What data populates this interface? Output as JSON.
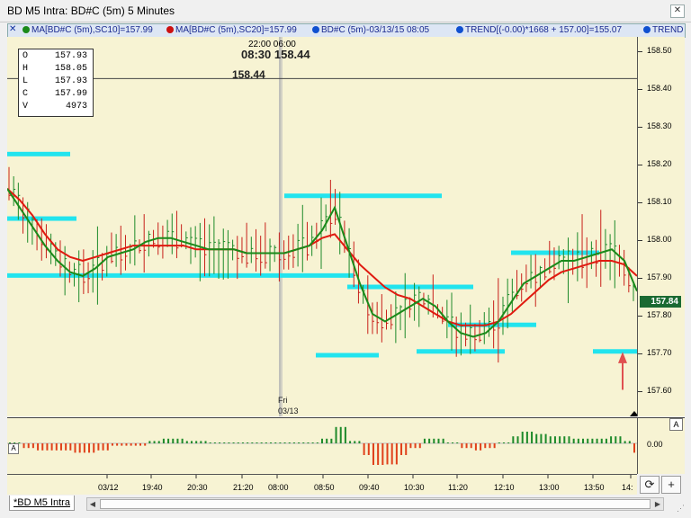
{
  "window": {
    "title": "BD M5 Intra: BD#C (5m) 5 Minutes",
    "close_glyph": "✕"
  },
  "legend": {
    "close_glyph": "✕",
    "items": [
      {
        "label": "MA[BD#C (5m),SC10]=157.99",
        "color": "#1a8a1a"
      },
      {
        "label": "MA[BD#C (5m),SC20]=157.99",
        "color": "#cc1010"
      },
      {
        "label": "BD#C (5m)-03/13/15 08:05",
        "color": "#1050d0"
      },
      {
        "label": "TREND[(-0.00)*1668 + 157.00]=155.07",
        "color": "#1050d0"
      },
      {
        "label": "TREND",
        "color": "#1050d0"
      }
    ]
  },
  "ohlc": {
    "rows": [
      {
        "k": "O",
        "v": "157.93"
      },
      {
        "k": "H",
        "v": "158.05"
      },
      {
        "k": "L",
        "v": "157.93"
      },
      {
        "k": "C",
        "v": "157.99"
      },
      {
        "k": "V",
        "v": "4973"
      }
    ]
  },
  "crosshair": {
    "time_top": "22:00  06:00",
    "time_big": "08:30  158.44",
    "price": "158.44"
  },
  "price_axis": {
    "min": 157.55,
    "max": 158.55,
    "labels": [
      "158.50",
      "158.40",
      "158.30",
      "158.20",
      "158.10",
      "158.00",
      "157.90",
      "157.80",
      "157.70",
      "157.60"
    ],
    "last_price": "157.84"
  },
  "osc_axis": {
    "zero_label": "0.00",
    "a_button": "A"
  },
  "session_marker": {
    "day": "Fri",
    "date": "03/13"
  },
  "time_axis": {
    "labels": [
      "03/12",
      "19:40",
      "20:30",
      "21:20",
      "08:00",
      "08:50",
      "09:40",
      "10:30",
      "11:20",
      "12:10",
      "13:00",
      "13:50",
      "14:"
    ]
  },
  "toolbar": {
    "refresh_icon": "⟳",
    "add_icon": "+"
  },
  "tabs": [
    {
      "label": "*BD M5 Intra"
    }
  ],
  "scroll": {
    "left_arrow": "◀",
    "right_arrow": "▶",
    "grip": "⋰"
  },
  "colors": {
    "background": "#f7f3d3",
    "up_bar": "#1d8a2a",
    "down_bar": "#c8201a",
    "ma10": "#1a8a1a",
    "ma20": "#e01a10",
    "trend_cyan": "#22e4ee",
    "annotation_arrow": "#e05050"
  },
  "chart_data": {
    "type": "bar",
    "series": [
      {
        "name": "MA SC10",
        "color": "#1a8a1a",
        "values": [
          158.15,
          158.1,
          158.05,
          158.0,
          157.96,
          157.93,
          157.92,
          157.94,
          157.97,
          157.98,
          157.99,
          158.01,
          158.02,
          158.02,
          158.01,
          158.0,
          157.99,
          157.99,
          157.99,
          157.98,
          157.98,
          157.98,
          157.98,
          157.99,
          158.0,
          158.04,
          158.1,
          158.0,
          157.9,
          157.82,
          157.8,
          157.82,
          157.84,
          157.86,
          157.84,
          157.8,
          157.77,
          157.76,
          157.77,
          157.8,
          157.85,
          157.9,
          157.92,
          157.94,
          157.96,
          157.96,
          157.97,
          157.98,
          157.99,
          157.96,
          157.88
        ]
      },
      {
        "name": "MA SC20",
        "color": "#e01a10",
        "values": [
          158.15,
          158.12,
          158.08,
          158.03,
          157.99,
          157.97,
          157.96,
          157.97,
          157.98,
          157.99,
          158.0,
          158.0,
          158.0,
          158.0,
          158.0,
          157.99,
          157.99,
          157.99,
          157.99,
          157.98,
          157.98,
          157.98,
          157.98,
          157.99,
          158.0,
          158.02,
          158.03,
          157.99,
          157.95,
          157.92,
          157.89,
          157.87,
          157.86,
          157.84,
          157.82,
          157.8,
          157.79,
          157.79,
          157.79,
          157.8,
          157.82,
          157.85,
          157.88,
          157.91,
          157.93,
          157.94,
          157.95,
          157.96,
          157.96,
          157.95,
          157.92
        ]
      }
    ],
    "horizontal_levels": [
      {
        "y": 158.24,
        "x_start": 0.0,
        "x_end": 0.1
      },
      {
        "y": 158.07,
        "x_start": 0.0,
        "x_end": 0.11
      },
      {
        "y": 157.92,
        "x_start": 0.0,
        "x_end": 0.55
      },
      {
        "y": 158.13,
        "x_start": 0.44,
        "x_end": 0.69
      },
      {
        "y": 157.89,
        "x_start": 0.54,
        "x_end": 0.74
      },
      {
        "y": 157.71,
        "x_start": 0.49,
        "x_end": 0.59
      },
      {
        "y": 157.72,
        "x_start": 0.65,
        "x_end": 0.79
      },
      {
        "y": 157.79,
        "x_start": 0.7,
        "x_end": 0.84
      },
      {
        "y": 157.98,
        "x_start": 0.8,
        "x_end": 0.94
      },
      {
        "y": 157.72,
        "x_start": 0.93,
        "x_end": 1.0
      }
    ],
    "ylim": [
      157.55,
      158.55
    ]
  }
}
